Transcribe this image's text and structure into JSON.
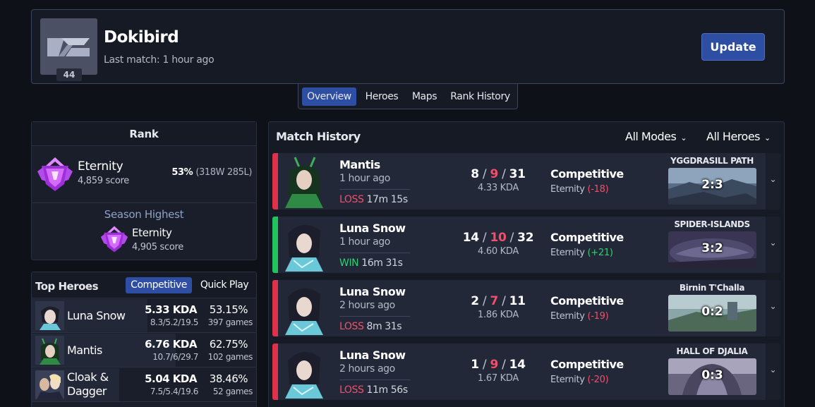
{
  "profile": {
    "name": "Dokibird",
    "last_match": "Last match: 1 hour ago",
    "level": "44",
    "update_label": "Update"
  },
  "tabs": [
    "Overview",
    "Heroes",
    "Maps",
    "Rank History"
  ],
  "rank": {
    "title": "Rank",
    "tier": "Eternity",
    "score": "4,859 score",
    "winrate": "53%",
    "record": "(318W 285L)",
    "season_title": "Season Highest",
    "season_tier": "Eternity",
    "season_score": "4,905 score"
  },
  "top_heroes": {
    "title": "Top Heroes",
    "tab_competitive": "Competitive",
    "tab_quickplay": "Quick Play",
    "rows": [
      {
        "name": "Luna Snow",
        "kda": "5.33 KDA",
        "kda_detail": "8.3/5.2/19.5",
        "winrate": "53.15%",
        "games": "397 games"
      },
      {
        "name": "Mantis",
        "kda": "6.76 KDA",
        "kda_detail": "10.7/6/29.7",
        "winrate": "62.75%",
        "games": "102 games"
      },
      {
        "name_line1": "Cloak &",
        "name_line2": "Dagger",
        "kda": "5.04 KDA",
        "kda_detail": "7.5/5.4/19.6",
        "winrate": "38.46%",
        "games": "52 games"
      }
    ]
  },
  "match_history": {
    "title": "Match History",
    "filter_modes": "All Modes",
    "filter_heroes": "All Heroes",
    "matches": [
      {
        "hero": "Mantis",
        "time": "1 hour ago",
        "result": "LOSS",
        "duration": "17m 15s",
        "k": "8",
        "d": "9",
        "a": "31",
        "kda": "4.33 KDA",
        "mode": "Competitive",
        "rank": "Eternity",
        "rank_change": "(-18)",
        "map": "YGGDRASILL PATH",
        "score": "2:3"
      },
      {
        "hero": "Luna Snow",
        "time": "1 hour ago",
        "result": "WIN",
        "duration": "16m 31s",
        "k": "14",
        "d": "10",
        "a": "32",
        "kda": "4.60 KDA",
        "mode": "Competitive",
        "rank": "Eternity",
        "rank_change": "(+21)",
        "map": "SPIDER-ISLANDS",
        "score": "3:2"
      },
      {
        "hero": "Luna Snow",
        "time": "2 hours ago",
        "result": "LOSS",
        "duration": "8m 31s",
        "k": "2",
        "d": "7",
        "a": "11",
        "kda": "1.86 KDA",
        "mode": "Competitive",
        "rank": "Eternity",
        "rank_change": "(-19)",
        "map": "Birnin T'Challa",
        "score": "0:2"
      },
      {
        "hero": "Luna Snow",
        "time": "2 hours ago",
        "result": "LOSS",
        "duration": "11m 56s",
        "k": "1",
        "d": "9",
        "a": "14",
        "kda": "1.67 KDA",
        "mode": "Competitive",
        "rank": "Eternity",
        "rank_change": "(-20)",
        "map": "HALL OF DJALIA",
        "score": "0:3"
      }
    ]
  },
  "colors": {
    "accent": "#2d4ea3",
    "loss": "#e0314c",
    "win": "#22c25e",
    "background": "#0f1118"
  },
  "icons": [
    "chevron-down-icon",
    "eternity-rank-icon"
  ]
}
